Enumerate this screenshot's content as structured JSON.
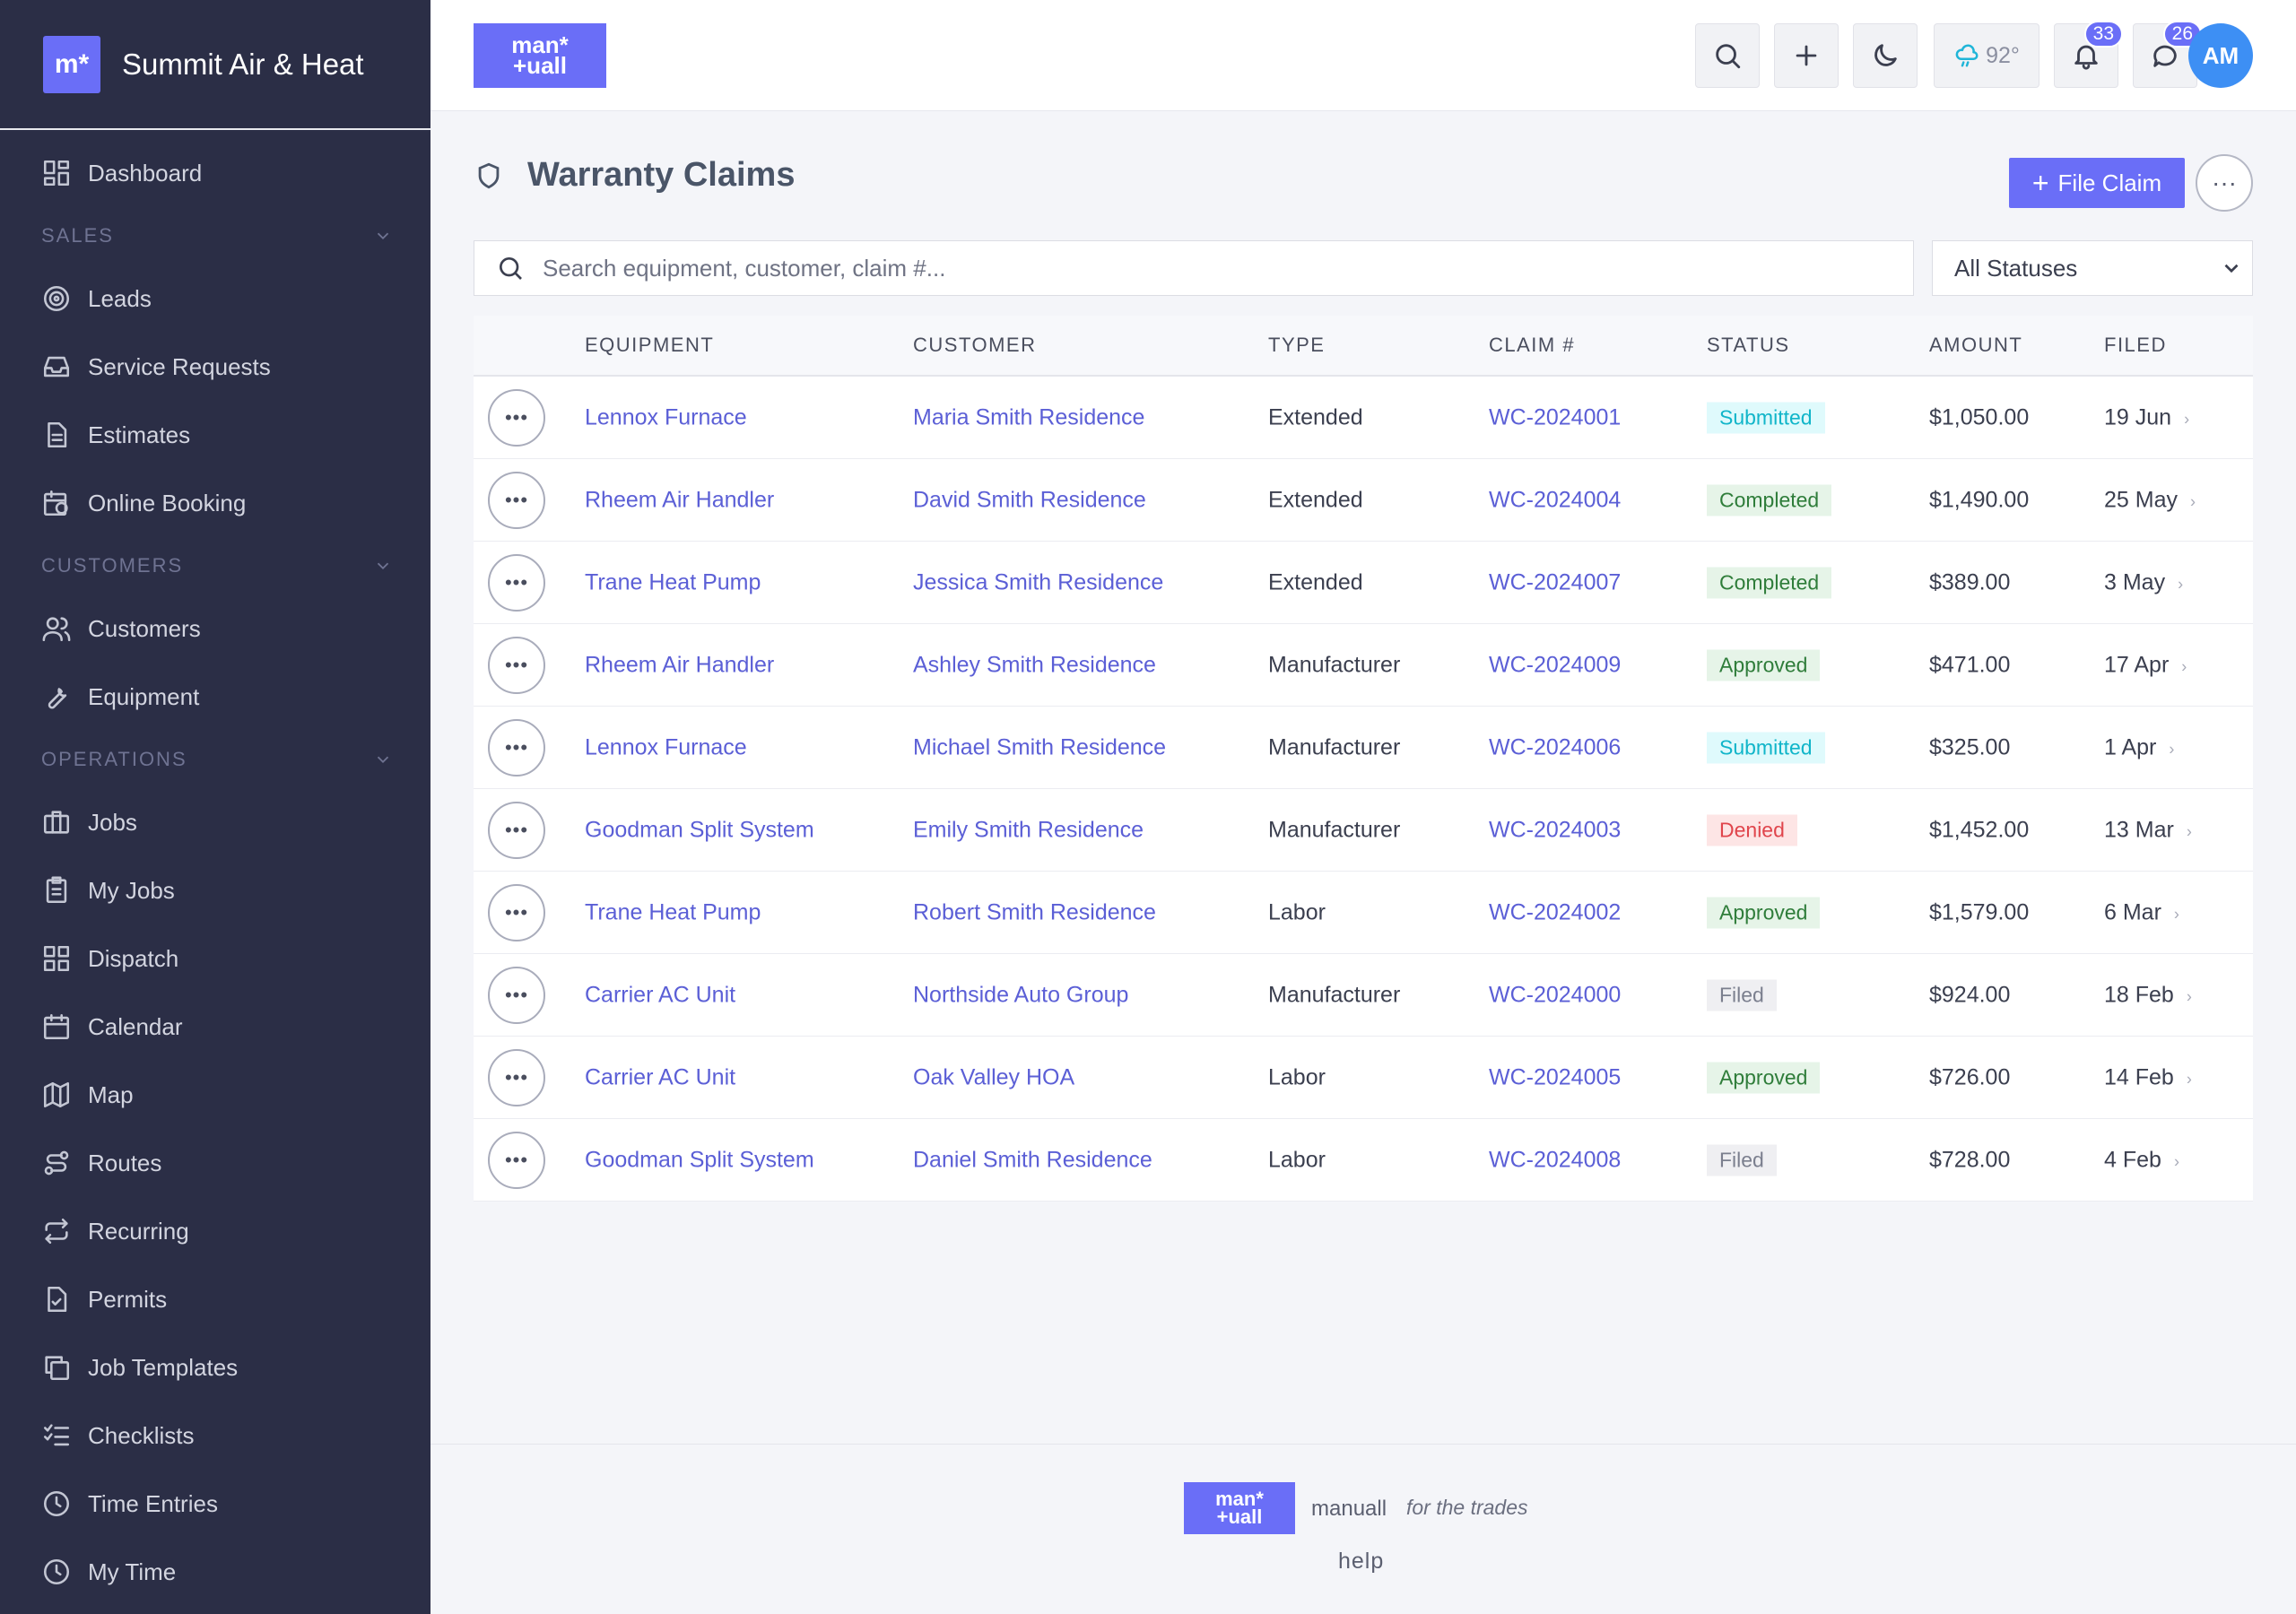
{
  "app": {
    "brand_mark": "m*",
    "company": "Summit Air & Heat",
    "logo_text": "man*\n+uall"
  },
  "sidebar": {
    "items": [
      {
        "type": "item",
        "label": "Dashboard",
        "icon": "dashboard-icon"
      },
      {
        "type": "section",
        "label": "SALES"
      },
      {
        "type": "item",
        "label": "Leads",
        "icon": "target-icon"
      },
      {
        "type": "item",
        "label": "Service Requests",
        "icon": "inbox-icon"
      },
      {
        "type": "item",
        "label": "Estimates",
        "icon": "document-icon"
      },
      {
        "type": "item",
        "label": "Online Booking",
        "icon": "calendar-clock-icon"
      },
      {
        "type": "section",
        "label": "CUSTOMERS"
      },
      {
        "type": "item",
        "label": "Customers",
        "icon": "users-icon"
      },
      {
        "type": "item",
        "label": "Equipment",
        "icon": "wrench-icon"
      },
      {
        "type": "section",
        "label": "OPERATIONS"
      },
      {
        "type": "item",
        "label": "Jobs",
        "icon": "briefcase-icon"
      },
      {
        "type": "item",
        "label": "My Jobs",
        "icon": "clipboard-icon"
      },
      {
        "type": "item",
        "label": "Dispatch",
        "icon": "grid-icon"
      },
      {
        "type": "item",
        "label": "Calendar",
        "icon": "calendar-icon"
      },
      {
        "type": "item",
        "label": "Map",
        "icon": "map-icon"
      },
      {
        "type": "item",
        "label": "Routes",
        "icon": "route-icon"
      },
      {
        "type": "item",
        "label": "Recurring",
        "icon": "repeat-icon"
      },
      {
        "type": "item",
        "label": "Permits",
        "icon": "file-check-icon"
      },
      {
        "type": "item",
        "label": "Job Templates",
        "icon": "copy-icon"
      },
      {
        "type": "item",
        "label": "Checklists",
        "icon": "list-check-icon"
      },
      {
        "type": "item",
        "label": "Time Entries",
        "icon": "clock-icon"
      },
      {
        "type": "item",
        "label": "My Time",
        "icon": "clock-icon"
      }
    ]
  },
  "topbar": {
    "weather": "92°",
    "notifications_count": "33",
    "messages_count": "26",
    "avatar_initials": "AM"
  },
  "page": {
    "title": "Warranty Claims",
    "file_claim_label": "File Claim",
    "more_label": "···"
  },
  "filters": {
    "search_placeholder": "Search equipment, customer, claim #...",
    "status_value": "All Statuses"
  },
  "table": {
    "headers": [
      "EQUIPMENT",
      "CUSTOMER",
      "TYPE",
      "CLAIM #",
      "STATUS",
      "AMOUNT",
      "FILED"
    ],
    "rows": [
      {
        "equipment": "Lennox Furnace",
        "customer": "Maria Smith Residence",
        "type": "Extended",
        "claim": "WC-2024001",
        "status": "Submitted",
        "amount": "$1,050.00",
        "filed": "19 Jun"
      },
      {
        "equipment": "Rheem Air Handler",
        "customer": "David Smith Residence",
        "type": "Extended",
        "claim": "WC-2024004",
        "status": "Completed",
        "amount": "$1,490.00",
        "filed": "25 May"
      },
      {
        "equipment": "Trane Heat Pump",
        "customer": "Jessica Smith Residence",
        "type": "Extended",
        "claim": "WC-2024007",
        "status": "Completed",
        "amount": "$389.00",
        "filed": "3 May"
      },
      {
        "equipment": "Rheem Air Handler",
        "customer": "Ashley Smith Residence",
        "type": "Manufacturer",
        "claim": "WC-2024009",
        "status": "Approved",
        "amount": "$471.00",
        "filed": "17 Apr"
      },
      {
        "equipment": "Lennox Furnace",
        "customer": "Michael Smith Residence",
        "type": "Manufacturer",
        "claim": "WC-2024006",
        "status": "Submitted",
        "amount": "$325.00",
        "filed": "1 Apr"
      },
      {
        "equipment": "Goodman Split System",
        "customer": "Emily Smith Residence",
        "type": "Manufacturer",
        "claim": "WC-2024003",
        "status": "Denied",
        "amount": "$1,452.00",
        "filed": "13 Mar"
      },
      {
        "equipment": "Trane Heat Pump",
        "customer": "Robert Smith Residence",
        "type": "Labor",
        "claim": "WC-2024002",
        "status": "Approved",
        "amount": "$1,579.00",
        "filed": "6 Mar"
      },
      {
        "equipment": "Carrier AC Unit",
        "customer": "Northside Auto Group",
        "type": "Manufacturer",
        "claim": "WC-2024000",
        "status": "Filed",
        "amount": "$924.00",
        "filed": "18 Feb"
      },
      {
        "equipment": "Carrier AC Unit",
        "customer": "Oak Valley HOA",
        "type": "Labor",
        "claim": "WC-2024005",
        "status": "Approved",
        "amount": "$726.00",
        "filed": "14 Feb"
      },
      {
        "equipment": "Goodman Split System",
        "customer": "Daniel Smith Residence",
        "type": "Labor",
        "claim": "WC-2024008",
        "status": "Filed",
        "amount": "$728.00",
        "filed": "4 Feb"
      }
    ]
  },
  "footer": {
    "name": "manuall",
    "tagline": "for the trades",
    "help": "help"
  },
  "colors": {
    "accent": "#6a6ef7",
    "sidebar_bg": "#2b2e46",
    "link": "#5b5fd6",
    "avatar": "#3d8ff4"
  }
}
